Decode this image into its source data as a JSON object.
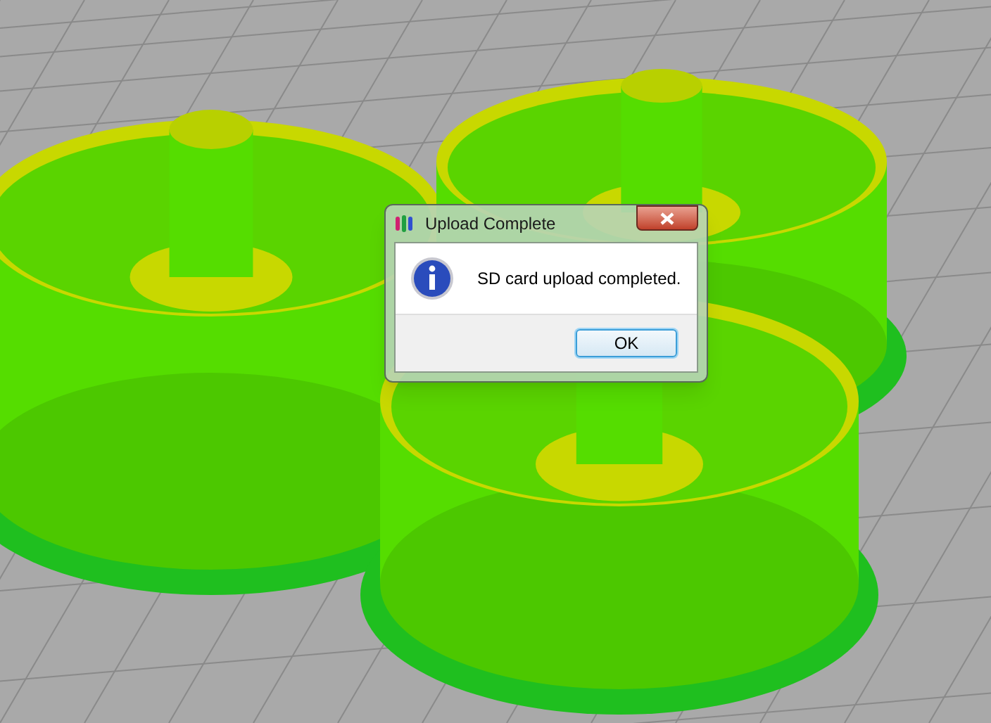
{
  "dialog": {
    "title": "Upload Complete",
    "message": "SD card upload completed.",
    "buttons": [
      {
        "label": "OK",
        "selected": true
      }
    ]
  }
}
